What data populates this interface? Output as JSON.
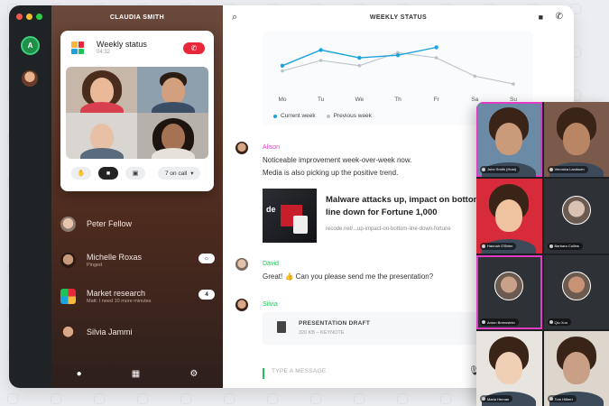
{
  "colors": {
    "accent_green": "#1ec45a",
    "current_week": "#1aa3dd",
    "previous_week": "#b9c3ca",
    "hangup_red": "#e8273b",
    "highlight_pink": "#e03cc4"
  },
  "workspace": {
    "badge": "A"
  },
  "contacts_panel": {
    "title": "CLAUDIA SMITH",
    "call_card": {
      "title": "Weekly status",
      "duration": "04:32",
      "on_call_label": "7 on call",
      "controls": [
        "hand-icon",
        "video-icon",
        "screen-share-icon"
      ]
    },
    "items": [
      {
        "name": "Peter Fellow",
        "sub": "",
        "badge": ""
      },
      {
        "name": "Michelle Roxas",
        "sub": "Pinged",
        "badge": "☼"
      },
      {
        "name": "Market research",
        "sub": "Matt: I need 10 more minutes",
        "badge": "4"
      },
      {
        "name": "Silvia Jammi",
        "sub": "",
        "badge": ""
      }
    ],
    "toolbar": [
      "person-icon",
      "grid-icon",
      "gear-icon"
    ]
  },
  "main": {
    "title": "WEEKLY STATUS",
    "legend": {
      "current": "Current week",
      "previous": "Previous week"
    },
    "messages": [
      {
        "author": "Alison",
        "author_color": "#e03cc4",
        "lines": [
          "Noticeable improvement week-over-week now.",
          "Media is also picking up the positive trend."
        ]
      },
      {
        "author": "David",
        "author_color": "#1ec45a",
        "lines": [
          "Great! 👍 Can you please send me the presentation?"
        ]
      },
      {
        "author": "Silvia",
        "author_color": "#1ec45a",
        "lines": []
      }
    ],
    "link_preview": {
      "title": "Malware attacks up, impact on bottom line down for Fortune 1,000",
      "url": "recode.net/...up-impact-on-bottom-line-down-fortune",
      "thumb_text": "de"
    },
    "file": {
      "name": "PRESENTATION DRAFT",
      "meta": "320 KB – KEYNOTE"
    },
    "composer_placeholder": "TYPE A MESSAGE"
  },
  "chart_data": {
    "type": "line",
    "categories": [
      "Mo",
      "Tu",
      "We",
      "Th",
      "Fr",
      "Sa",
      "Su"
    ],
    "series": [
      {
        "name": "Current week",
        "values": [
          8,
          14,
          11,
          12,
          15,
          null,
          null
        ]
      },
      {
        "name": "Previous week",
        "values": [
          6,
          10,
          8,
          13,
          11,
          4,
          1
        ]
      }
    ],
    "ylim": [
      0,
      20
    ],
    "grid": false,
    "legend": "bottom-left"
  },
  "participants": [
    {
      "label": "John Smith (Host)",
      "tone": "#c99b7a",
      "bg": "#6a8aa5",
      "style": "photo"
    },
    {
      "label": "Veronica Landsom",
      "tone": "#b88565",
      "bg": "#7a5a4a",
      "style": "photo"
    },
    {
      "label": "Hannah O'Brien",
      "tone": "#f0c3a0",
      "bg": "#d72a3a",
      "style": "photo"
    },
    {
      "label": "Barbara Collins",
      "tone": "#d9c2b3",
      "bg": "#2e3135",
      "style": "circle"
    },
    {
      "label": "Anton Breenstein",
      "tone": "#c9a088",
      "bg": "#2e3135",
      "style": "circle"
    },
    {
      "label": "Qiu Xun",
      "tone": "#c89374",
      "bg": "#2e3135",
      "style": "circle"
    },
    {
      "label": "Maria Hernan",
      "tone": "#f0d0b5",
      "bg": "#e8e5e0",
      "style": "photo"
    },
    {
      "label": "Tom Hilbert",
      "tone": "#c9a085",
      "bg": "#ddd6cc",
      "style": "photo"
    }
  ]
}
